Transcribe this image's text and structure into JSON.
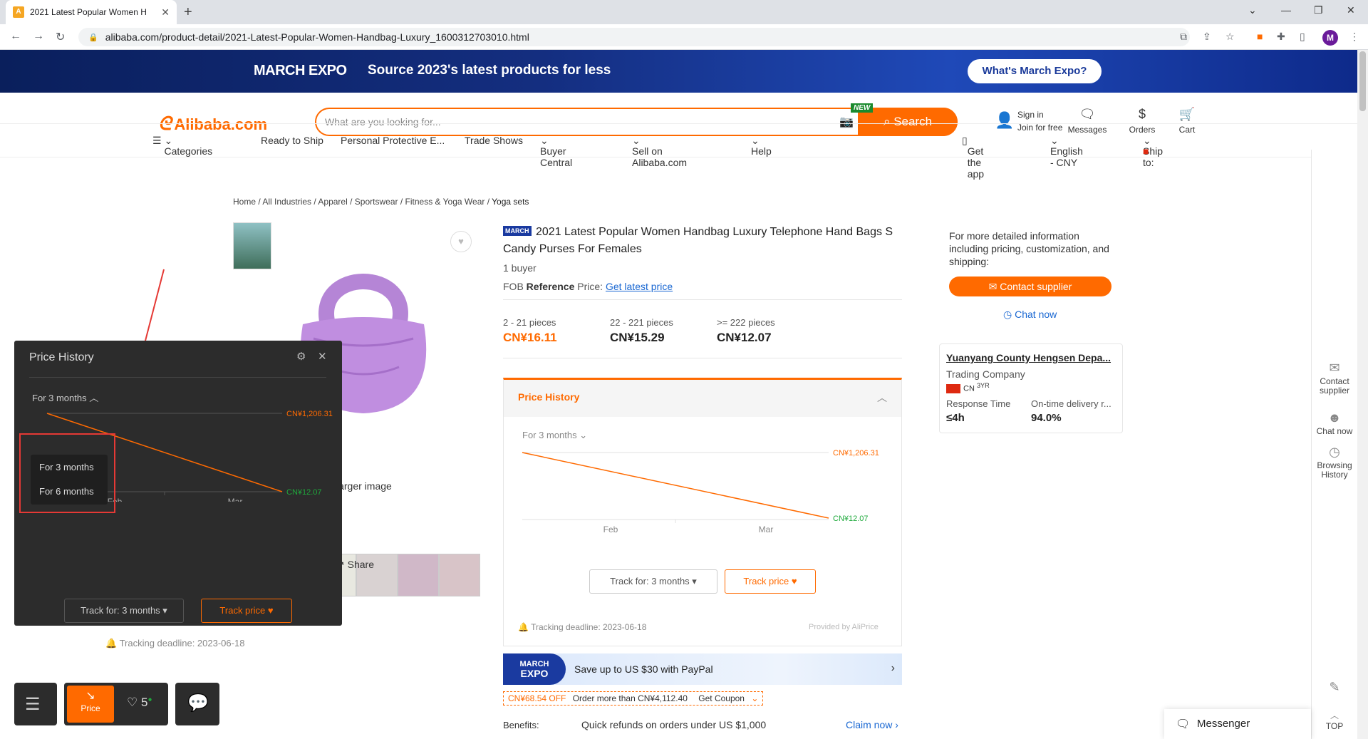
{
  "browser": {
    "tab_title": "2021 Latest Popular Women H",
    "url": "alibaba.com/product-detail/2021-Latest-Popular-Women-Handbag-Luxury_1600312703010.html",
    "profile_initial": "M"
  },
  "banner": {
    "event": "MARCH EXPO",
    "tagline": "Source 2023's latest products for less",
    "button": "What's March Expo?"
  },
  "header": {
    "logo": "Alibaba.com",
    "search_placeholder": "What are you looking for...",
    "new_badge": "NEW",
    "search_button": "Search",
    "sign_in": "Sign in",
    "join": "Join for free",
    "messages": "Messages",
    "orders": "Orders",
    "cart": "Cart"
  },
  "nav": {
    "categories": "Categories",
    "items": [
      "Ready to Ship",
      "Personal Protective E...",
      "Trade Shows",
      "Buyer Central",
      "Sell on Alibaba.com",
      "Help"
    ],
    "get_app": "Get the app",
    "language": "English - CNY",
    "ship_to": "Ship to:"
  },
  "breadcrumb": [
    "Home",
    "All Industries",
    "Apparel",
    "Sportswear",
    "Fitness & Yoga Wear",
    "Yoga sets"
  ],
  "gallery": {
    "view_larger": "w larger image",
    "share": "Share"
  },
  "product": {
    "badge": "MARCH",
    "title": "2021 Latest Popular Women Handbag Luxury Telephone Hand Bags S Candy Purses For Females",
    "buyers": "1 buyer",
    "fob_prefix": "FOB",
    "fob_ref": "Reference",
    "fob_suffix": "Price:",
    "latest_price_link": "Get latest price",
    "tiers": [
      {
        "qty": "2 - 21 pieces",
        "price": "CN¥16.11"
      },
      {
        "qty": "22 - 221 pieces",
        "price": "CN¥15.29"
      },
      {
        "qty": ">= 222 pieces",
        "price": "CN¥12.07"
      }
    ]
  },
  "price_history": {
    "title": "Price History",
    "range": "For 3 months",
    "high_label": "CN¥1,206.31",
    "low_label": "CN¥12.07",
    "months": [
      "Feb",
      "Mar"
    ],
    "track_for": "Track for: 3 months",
    "track_price": "Track price",
    "deadline": "Tracking deadline: 2023-06-18",
    "provider": "Provided by AliPrice"
  },
  "chart_data": {
    "type": "line",
    "x": [
      "Feb",
      "Mar"
    ],
    "series": [
      {
        "values": [
          1206.31,
          12.07
        ]
      }
    ],
    "annotations": [
      "CN¥1,206.31",
      "CN¥12.07"
    ]
  },
  "promo": {
    "badge_line1": "MARCH",
    "badge_line2": "EXPO",
    "paypal_text": "Save up to US $30 with PayPal",
    "coupon_off": "CN¥68.54 OFF",
    "coupon_cond": "Order more than CN¥4,112.40",
    "coupon_cta": "Get Coupon",
    "benefits_label": "Benefits:",
    "benefits_text": "Quick refunds on orders under US $1,000",
    "claim": "Claim now"
  },
  "supplier": {
    "info": "For more detailed information including pricing, customization, and shipping:",
    "contact_button": "Contact supplier",
    "chat_now": "Chat now",
    "name": "Yuanyang County Hengsen Depa...",
    "type": "Trading Company",
    "country": "CN",
    "years": "3YR",
    "response_label": "Response Time",
    "response_value": "≤4h",
    "delivery_label": "On-time delivery r...",
    "delivery_value": "94.0%"
  },
  "rail": {
    "contact": "Contact supplier",
    "chat": "Chat now",
    "history": "Browsing History",
    "top": "TOP"
  },
  "messenger": "Messenger",
  "floating": {
    "title": "Price History",
    "range": "For 3 months",
    "options": [
      "For 3 months",
      "For 6 months"
    ],
    "high_label": "CN¥1,206.31",
    "low_label": "CN¥12.07",
    "months": [
      "Feb",
      "Mar"
    ],
    "track_for": "Track for: 3 months",
    "track_price": "Track price",
    "deadline": "Tracking deadline: 2023-06-18",
    "price_tab": "Price",
    "fav_count": "5"
  },
  "colors": {
    "accent": "#ff6a00",
    "green": "#1faa3c",
    "panel": "#2c2c2c"
  }
}
